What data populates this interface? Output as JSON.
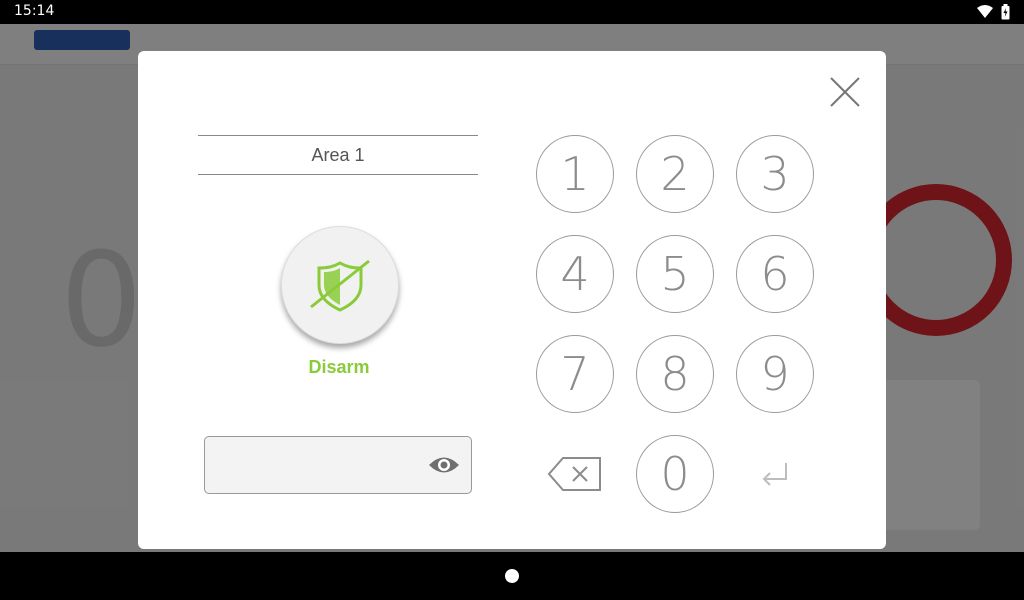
{
  "status_bar": {
    "time": "15:14",
    "icons": [
      "wifi-icon",
      "battery-icon"
    ]
  },
  "dialog": {
    "area_label": "Area 1",
    "mode_label": "Disarm",
    "pin_input": {
      "value": "",
      "placeholder": ""
    },
    "keypad": {
      "keys": [
        "1",
        "2",
        "3",
        "4",
        "5",
        "6",
        "7",
        "8",
        "9",
        "0"
      ],
      "backspace_icon": "backspace-icon",
      "enter_icon": "enter-icon"
    }
  },
  "colors": {
    "accent_green": "#8acb3a",
    "alarm_red": "#d4272e"
  }
}
